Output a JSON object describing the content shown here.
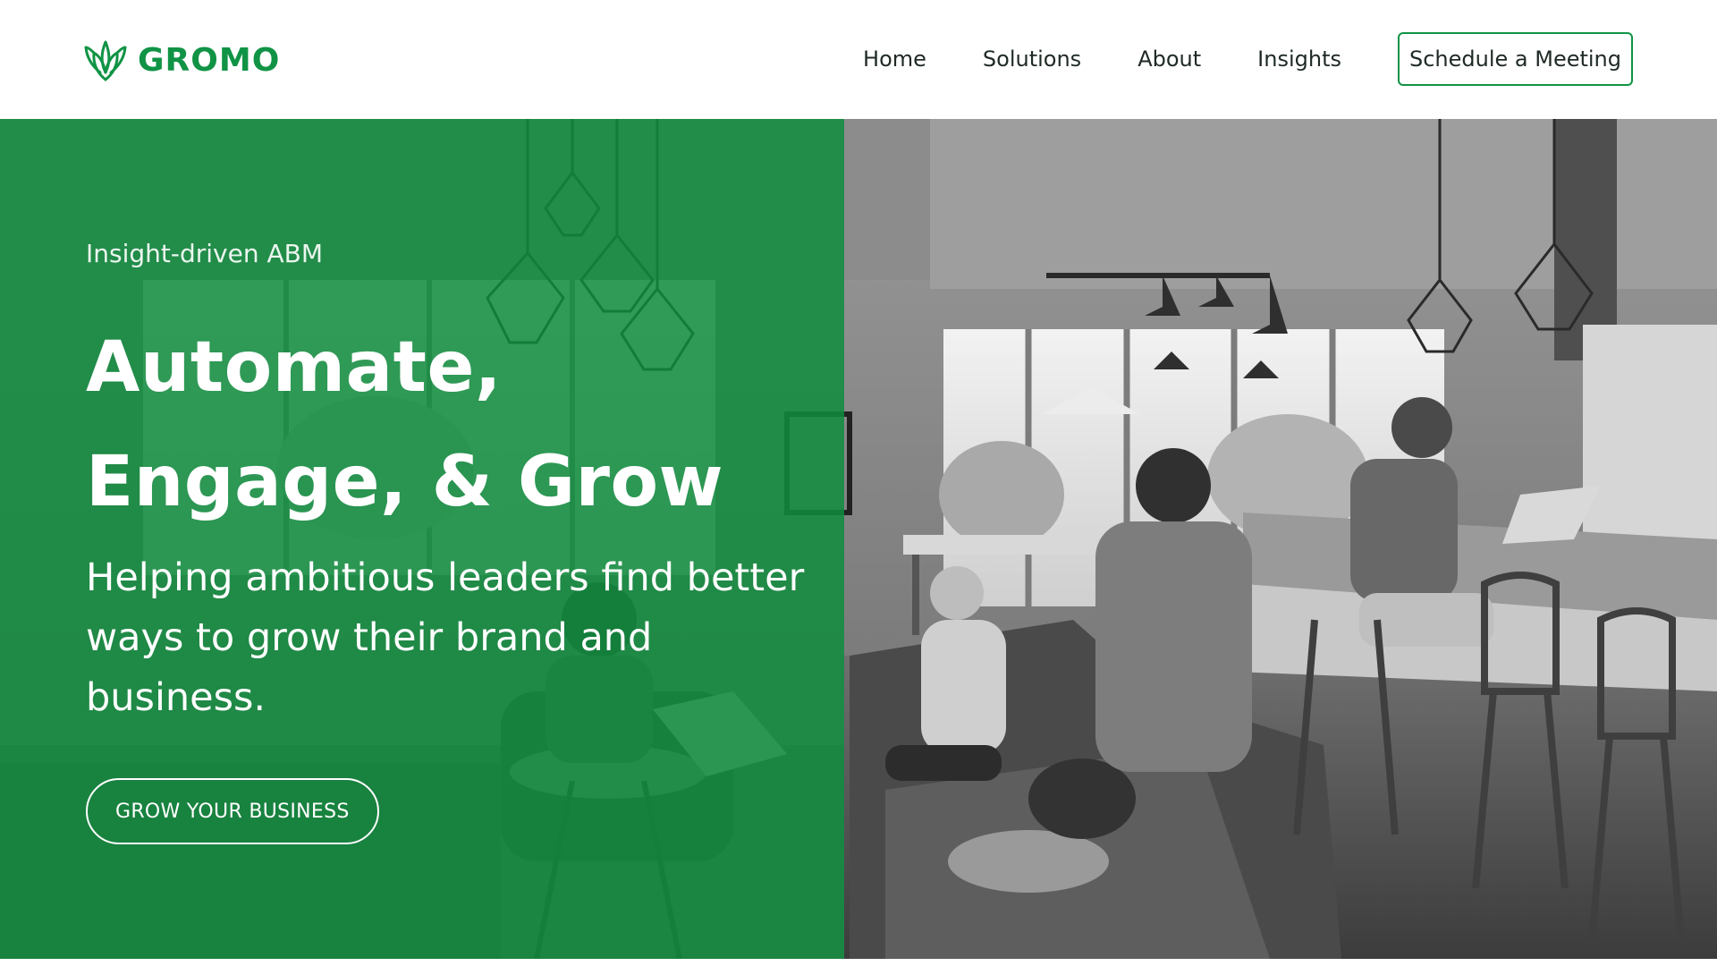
{
  "brand": {
    "name": "GROMO",
    "color": "#109345",
    "icon": "leaf-logo-icon"
  },
  "nav": {
    "items": [
      {
        "label": "Home"
      },
      {
        "label": "Solutions"
      },
      {
        "label": "About"
      },
      {
        "label": "Insights"
      }
    ],
    "cta_label": "Schedule a Meeting"
  },
  "hero": {
    "eyebrow": "Insight-driven ABM",
    "headline_line1": "Automate,",
    "headline_line2": "Engage, & Grow",
    "subhead": "Helping ambitious leaders find better ways to grow their brand and business.",
    "cta_label": "GROW YOUR BUSINESS",
    "overlay_color": "#108c3e",
    "image": "grayscale-office-lounge-photo"
  }
}
